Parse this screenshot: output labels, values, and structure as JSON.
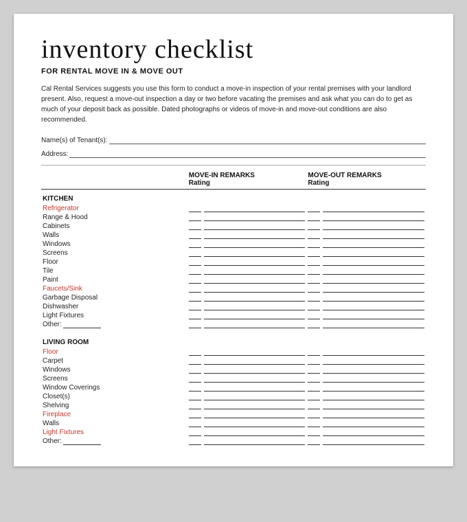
{
  "title": "inventory checklist",
  "subtitle": "FOR RENTAL MOVE IN & MOVE OUT",
  "intro": "Cal Rental Services suggests you use this form to conduct a move-in inspection of your rental premises with your landlord present.  Also, request a move-out inspection a day or two before vacating the premises and ask what you can do to get as much of your deposit back as possible. Dated photographs or videos of move-in and move-out conditions are also recommended.",
  "fields": {
    "tenants_label": "Name(s) of Tenant(s):",
    "address_label": "Address:"
  },
  "columns": {
    "item": "",
    "movein_header": "MOVE-IN REMARKS",
    "movein_sub": "Rating",
    "moveout_header": "MOVE-OUT REMARKS",
    "moveout_sub": "Rating"
  },
  "kitchen": {
    "section_label": "KITCHEN",
    "items": [
      {
        "name": "Refrigerator",
        "highlight": true
      },
      {
        "name": "Range & Hood",
        "highlight": false
      },
      {
        "name": "Cabinets",
        "highlight": false
      },
      {
        "name": "Walls",
        "highlight": false
      },
      {
        "name": "Windows",
        "highlight": false
      },
      {
        "name": "Screens",
        "highlight": false
      },
      {
        "name": "Floor",
        "highlight": false
      },
      {
        "name": "Tile",
        "highlight": false
      },
      {
        "name": "Paint",
        "highlight": false
      },
      {
        "name": "Faucets/Sink",
        "highlight": true
      },
      {
        "name": "Garbage Disposal",
        "highlight": false
      },
      {
        "name": "Dishwasher",
        "highlight": false
      },
      {
        "name": "Light Fixtures",
        "highlight": false
      }
    ],
    "other_label": "Other:"
  },
  "living_room": {
    "section_label": "LIVING ROOM",
    "items": [
      {
        "name": "Floor",
        "highlight": true
      },
      {
        "name": "Carpet",
        "highlight": false
      },
      {
        "name": "Windows",
        "highlight": false
      },
      {
        "name": "Screens",
        "highlight": false
      },
      {
        "name": "Window Coverings",
        "highlight": false
      },
      {
        "name": "Closet(s)",
        "highlight": false
      },
      {
        "name": "Shelving",
        "highlight": false
      },
      {
        "name": "Fireplace",
        "highlight": true
      },
      {
        "name": "Walls",
        "highlight": false
      },
      {
        "name": "Light Fixtures",
        "highlight": true
      }
    ],
    "other_label": "Other:"
  }
}
